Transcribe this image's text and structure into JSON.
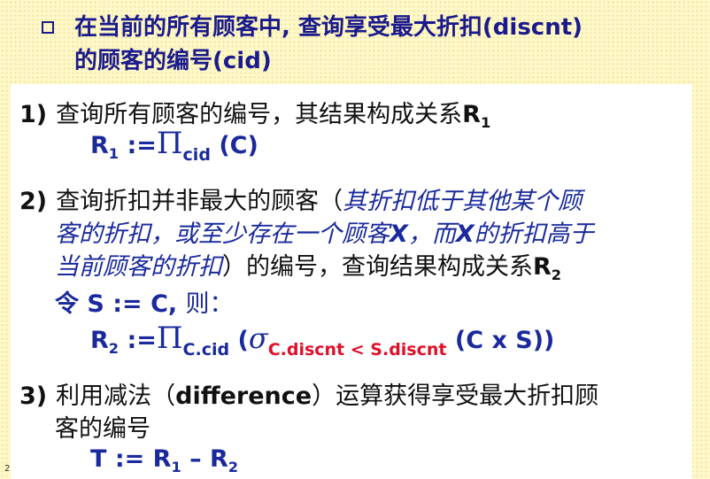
{
  "header": {
    "title_line1": "在当前的所有顾客中, 查询享受最大折扣(discnt)",
    "title_line2": "的顾客的编号(cid)"
  },
  "step1": {
    "num": "1)",
    "text": "查询所有顾客的编号，其结果构成关系",
    "rel": "R",
    "rel_sub": "1",
    "f_lhs": "R",
    "f_lhs_sub": "1",
    "f_assign": " :=",
    "f_pi": "Π",
    "f_pi_sub": "cid",
    "f_rest": " (C)"
  },
  "step2": {
    "num": "2)",
    "text_a": "查询折扣并非最大的顾客（",
    "italic_1": "其折扣低于其他某个顾",
    "italic_2a": "客的折扣，或至少存在一个顾客",
    "italic_x1": "X",
    "italic_2b": "，而",
    "italic_x2": "X",
    "italic_2c": "的折扣高于",
    "italic_3": "当前顾客的折扣",
    "text_b": "）的编号，查询结果构成关系",
    "rel": "R",
    "rel_sub": "2",
    "let_a": "令 S := C, ",
    "let_b": "则：",
    "f_lhs": "R",
    "f_lhs_sub": "2",
    "f_assign": " :=",
    "f_pi": "Π",
    "f_pi_sub": "C.cid",
    "f_open": " (",
    "f_sigma": "σ",
    "f_cond": "C.discnt < S.discnt",
    "f_rest": " (C x S))"
  },
  "step3": {
    "num": "3)",
    "text_a": "利用减法（",
    "diff": "difference",
    "text_b": "）运算获得享受最大折扣顾",
    "text_c": "客的编号",
    "f_t": "T := R",
    "f_sub1": "1",
    "f_minus": " – R",
    "f_sub2": "2"
  },
  "footer": {
    "page": "2"
  }
}
